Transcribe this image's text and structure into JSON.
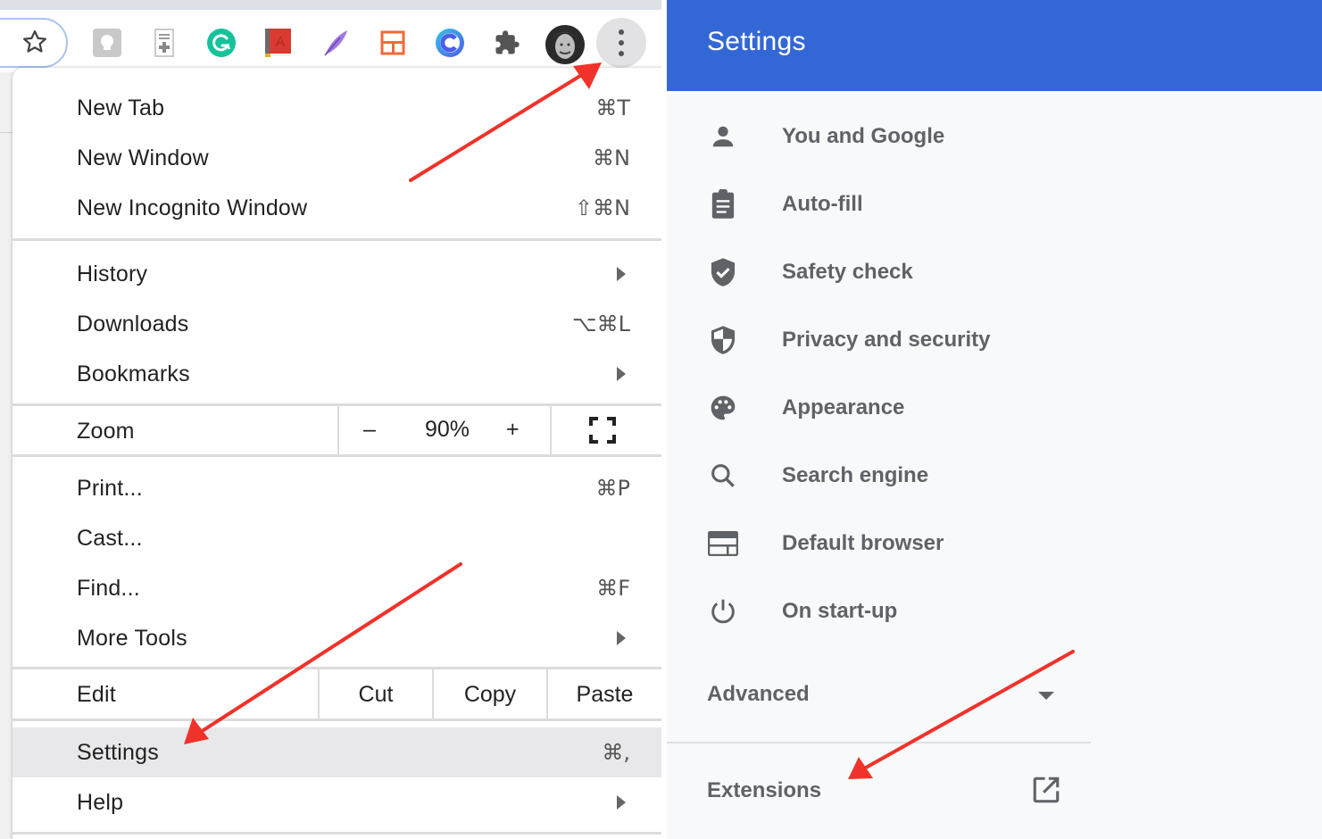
{
  "toolbar": {
    "icons": [
      {
        "name": "bookmark-star-icon"
      },
      {
        "name": "lightbulb-extension-icon"
      },
      {
        "name": "doc-plus-extension-icon"
      },
      {
        "name": "grammarly-extension-icon",
        "color": "#15c39a"
      },
      {
        "name": "red-book-extension-icon",
        "color": "#d93a32"
      },
      {
        "name": "feather-extension-icon",
        "color": "#8e5fd8"
      },
      {
        "name": "layout-extension-icon",
        "color": "#ef6a3a"
      },
      {
        "name": "c-extension-icon",
        "color": "#3b82f6"
      },
      {
        "name": "extensions-puzzle-icon"
      },
      {
        "name": "profile-avatar"
      },
      {
        "name": "more-menu-icon"
      }
    ]
  },
  "menu": {
    "new_tab": {
      "label": "New Tab",
      "shortcut": "⌘T"
    },
    "new_window": {
      "label": "New Window",
      "shortcut": "⌘N"
    },
    "new_incognito": {
      "label": "New Incognito Window",
      "shortcut": "⇧⌘N"
    },
    "history": {
      "label": "History"
    },
    "downloads": {
      "label": "Downloads",
      "shortcut": "⌥⌘L"
    },
    "bookmarks": {
      "label": "Bookmarks"
    },
    "zoom": {
      "label": "Zoom",
      "minus": "–",
      "value": "90%",
      "plus": "+"
    },
    "print": {
      "label": "Print...",
      "shortcut": "⌘P"
    },
    "cast": {
      "label": "Cast..."
    },
    "find": {
      "label": "Find...",
      "shortcut": "⌘F"
    },
    "more_tools": {
      "label": "More Tools"
    },
    "edit": {
      "label": "Edit",
      "cut": "Cut",
      "copy": "Copy",
      "paste": "Paste"
    },
    "settings": {
      "label": "Settings",
      "shortcut": "⌘,"
    },
    "help": {
      "label": "Help"
    }
  },
  "settings": {
    "title": "Settings",
    "accent": "#3367d6",
    "nav": [
      {
        "label": "You and Google",
        "icon": "person-icon"
      },
      {
        "label": "Auto-fill",
        "icon": "clipboard-icon"
      },
      {
        "label": "Safety check",
        "icon": "shield-check-icon"
      },
      {
        "label": "Privacy and security",
        "icon": "shield-half-icon"
      },
      {
        "label": "Appearance",
        "icon": "palette-icon"
      },
      {
        "label": "Search engine",
        "icon": "search-icon"
      },
      {
        "label": "Default browser",
        "icon": "browser-window-icon"
      },
      {
        "label": "On start-up",
        "icon": "power-icon"
      }
    ],
    "advanced": "Advanced",
    "extensions": "Extensions"
  },
  "annotation": {
    "arrow_color": "#f0322a"
  }
}
